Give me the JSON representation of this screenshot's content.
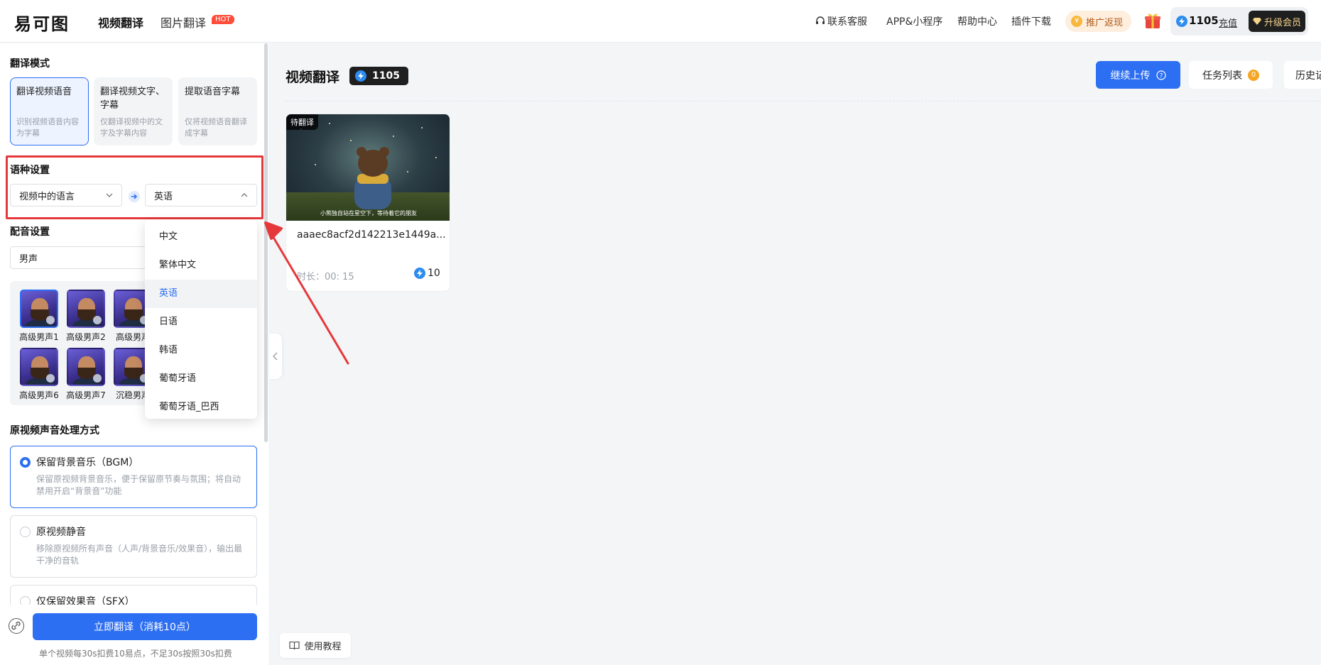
{
  "header": {
    "logo": "易可图",
    "tabs": [
      {
        "label": "视频翻译",
        "active": true
      },
      {
        "label": "图片翻译",
        "active": false
      }
    ],
    "hot_badge": "HOT",
    "links": [
      "联系客服",
      "APP&小程序",
      "帮助中心",
      "插件下载"
    ],
    "promo_label": "推广返现",
    "balance": "1105",
    "recharge_label": "充值",
    "upgrade_label": "升级会员"
  },
  "left": {
    "mode_title": "翻译模式",
    "modes": [
      {
        "title": "翻译视频语音",
        "desc": "识别视频语音内容为字幕",
        "active": true
      },
      {
        "title": "翻译视频文字、字幕",
        "desc": "仅翻译视频中的文字及字幕内容",
        "active": false
      },
      {
        "title": "提取语音字幕",
        "desc": "仅将视频语音翻译成字幕",
        "active": false
      }
    ],
    "language_title": "语种设置",
    "source_lang": "视频中的语言",
    "target_lang": "英语",
    "dubbing_title": "配音设置",
    "dubbing_value": "男声",
    "voices": [
      "高级男声1",
      "高级男声2",
      "高级男声",
      "高级男声6",
      "高级男声7",
      "沉稳男声"
    ],
    "audio_title": "原视频声音处理方式",
    "audio_options": [
      {
        "title": "保留背景音乐（BGM）",
        "desc": "保留原视频背景音乐，便于保留原节奏与氛围；将自动禁用开启“背景音”功能",
        "active": true
      },
      {
        "title": "原视频静音",
        "desc": "移除原视频所有声音（人声/背景音乐/效果音），输出最干净的音轨",
        "active": false
      },
      {
        "title": "仅保留效果音（SFX）",
        "desc": "",
        "active": false
      }
    ],
    "translate_btn": "立即翻译（消耗10点）",
    "foot_note": "单个视频每30s扣费10易点，不足30s按照30s扣费"
  },
  "dropdown": {
    "items": [
      "中文",
      "繁体中文",
      "英语",
      "日语",
      "韩语",
      "葡萄牙语",
      "葡萄牙语_巴西"
    ],
    "selected": "英语"
  },
  "main": {
    "title": "视频翻译",
    "credits": "1105",
    "continue_upload": "继续上传",
    "task_list": "任务列表",
    "task_count": "0",
    "history": "历史记",
    "video": {
      "status": "待翻译",
      "name": "aaaec8acf2d142213e1449a...",
      "duration": "时长：00: 15",
      "cost": "10",
      "subtitle": "小熊独自站在星空下，等待着它的朋友"
    },
    "tutorial": "使用教程"
  },
  "colors": {
    "primary": "#2d6ff2",
    "annotation": "#e5383b",
    "badge_dark": "#1f1f1f"
  }
}
